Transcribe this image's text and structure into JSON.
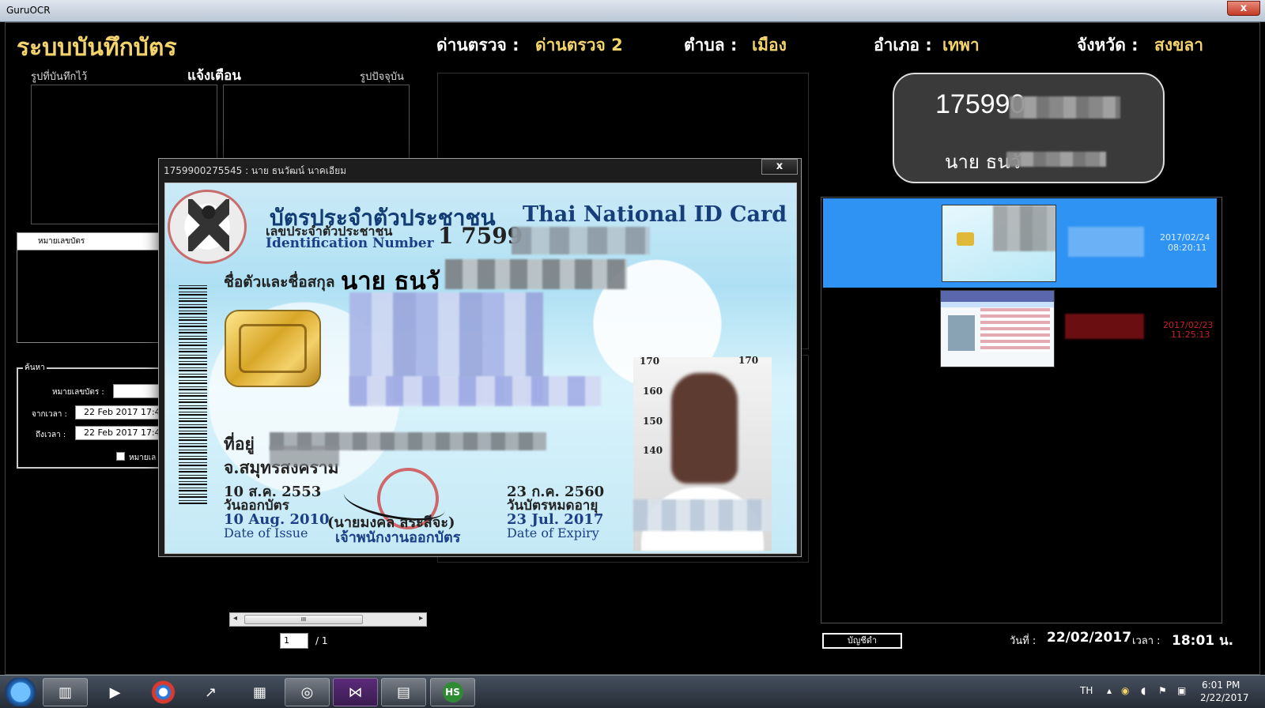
{
  "window": {
    "title": "GuruOCR",
    "close": "x"
  },
  "header": {
    "app_title": "ระบบบันทึกบัตร",
    "checkpoint_label": "ด่านตรวจ :",
    "checkpoint_value": "ด่านตรวจ 2",
    "subdistrict_label": "ตำบล :",
    "subdistrict_value": "เมือง",
    "district_label": "อำเภอ :",
    "district_value": "เทพา",
    "province_label": "จังหวัด :",
    "province_value": "สงขลา"
  },
  "left_panel": {
    "saved_image_label": "รูปที่บันทึกไว้",
    "alert_label": "แจ้งเตือน",
    "current_image_label": "รูปปัจจุบัน",
    "list_header": "หมายเลขบัตร"
  },
  "search": {
    "legend": "ค้นหา",
    "card_no_label": "หมายเลขบัตร :",
    "from_label": "จากเวลา :",
    "from_value": "22 Feb 2017  17:4",
    "to_label": "ถึงเวลา :",
    "to_value": "22 Feb 2017  17:4",
    "checkbox_label": "หมายเล"
  },
  "pager": {
    "page": "1",
    "total": "/ 1",
    "scroll_glyph": "III"
  },
  "id_display": {
    "number": "175990",
    "name": "นาย ธนวั"
  },
  "dialog": {
    "title": "1759900275545 : นาย ธนวัฒน์ นาคเอียม",
    "close": "x",
    "card": {
      "title_th": "บัตรประจำตัวประชาชน",
      "title_en": "Thai National ID Card",
      "id_label_th": "เลขประจำตัวประชาชน",
      "id_label_en": "Identification Number",
      "id_number": "1 7599",
      "name_label": "ชื่อตัวและชื่อสกุล",
      "name_value": "นาย ธนวั",
      "address_label": "ที่อยู่",
      "province_line": "จ.สมุทรสงคราม",
      "issue_th": "10 ส.ค. 2553",
      "issue_label_th": "วันออกบัตร",
      "issue_en": "10 Aug. 2010",
      "issue_label_en": "Date of Issue",
      "officer_name": "(นายมงคล สระสีจะ)",
      "officer_label": "เจ้าพนักงานออกบัตร",
      "expiry_th": "23 ก.ค. 2560",
      "expiry_label_th": "วันบัตรหมดอายุ",
      "expiry_en": "23 Jul. 2017",
      "expiry_label_en": "Date of Expiry",
      "ruler_170": "170",
      "ruler_170b": "170",
      "ruler_160": "160",
      "ruler_150": "150",
      "ruler_140": "140"
    }
  },
  "history": [
    {
      "date": "2017/02/24",
      "time": "08:20:11",
      "selected": true
    },
    {
      "date": "2017/02/23",
      "time": "11:25:13",
      "selected": false
    }
  ],
  "footer": {
    "report_button": "บัญชีดำ",
    "date_label": "วันที่ :",
    "date_value": "22/02/2017",
    "time_label": "เวลา :",
    "time_value": "18:01 น."
  },
  "taskbar": {
    "lang": "TH",
    "clock_time": "6:01 PM",
    "clock_date": "2/22/2017",
    "hs_label": "HS"
  },
  "colors": {
    "accent_yellow": "#f3d36b",
    "selected_blue": "#2f93f3",
    "history_red": "#c8202a"
  }
}
